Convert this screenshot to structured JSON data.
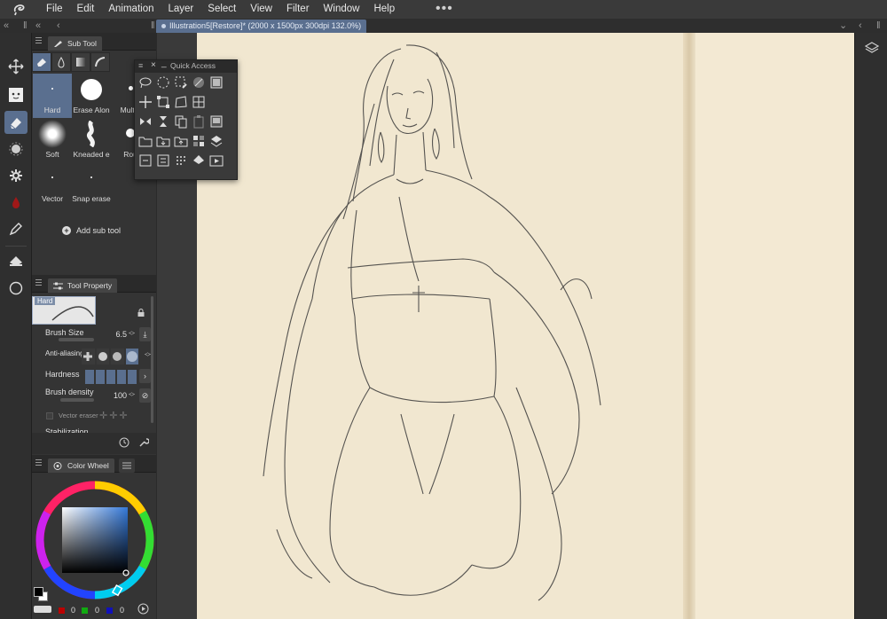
{
  "menu": {
    "items": [
      "File",
      "Edit",
      "Animation",
      "Layer",
      "Select",
      "View",
      "Filter",
      "Window",
      "Help"
    ],
    "more": "•••"
  },
  "tabs": {
    "document": "Illustration5[Restore]* (2000 x 1500px 300dpi 132.0%)"
  },
  "sub_tool": {
    "tab_label": "Sub Tool",
    "brushes": [
      {
        "label": "Hard"
      },
      {
        "label": "Erase Alon"
      },
      {
        "label": "Multip"
      },
      {
        "label": "Soft"
      },
      {
        "label": "Kneaded e"
      },
      {
        "label": "Rou"
      },
      {
        "label": "Vector"
      },
      {
        "label": "Snap erase"
      }
    ],
    "add_label": "Add sub tool"
  },
  "quick_access": {
    "title": "Quick Access"
  },
  "tool_property": {
    "tab_label": "Tool Property",
    "preview_name": "Hard",
    "brush_size_label": "Brush Size",
    "brush_size_value": "6.5",
    "antialias_label": "Anti-aliasing",
    "hardness_label": "Hardness",
    "brush_density_label": "Brush density",
    "brush_density_value": "100",
    "vector_eraser_label": "Vector eraser",
    "stabilization_label": "Stabilization"
  },
  "color_wheel": {
    "tab_label": "Color Wheel",
    "r": "0",
    "g": "0",
    "b": "0"
  },
  "colors": {
    "accent": "#5a6f8f",
    "paper": "#f1e7d0"
  }
}
